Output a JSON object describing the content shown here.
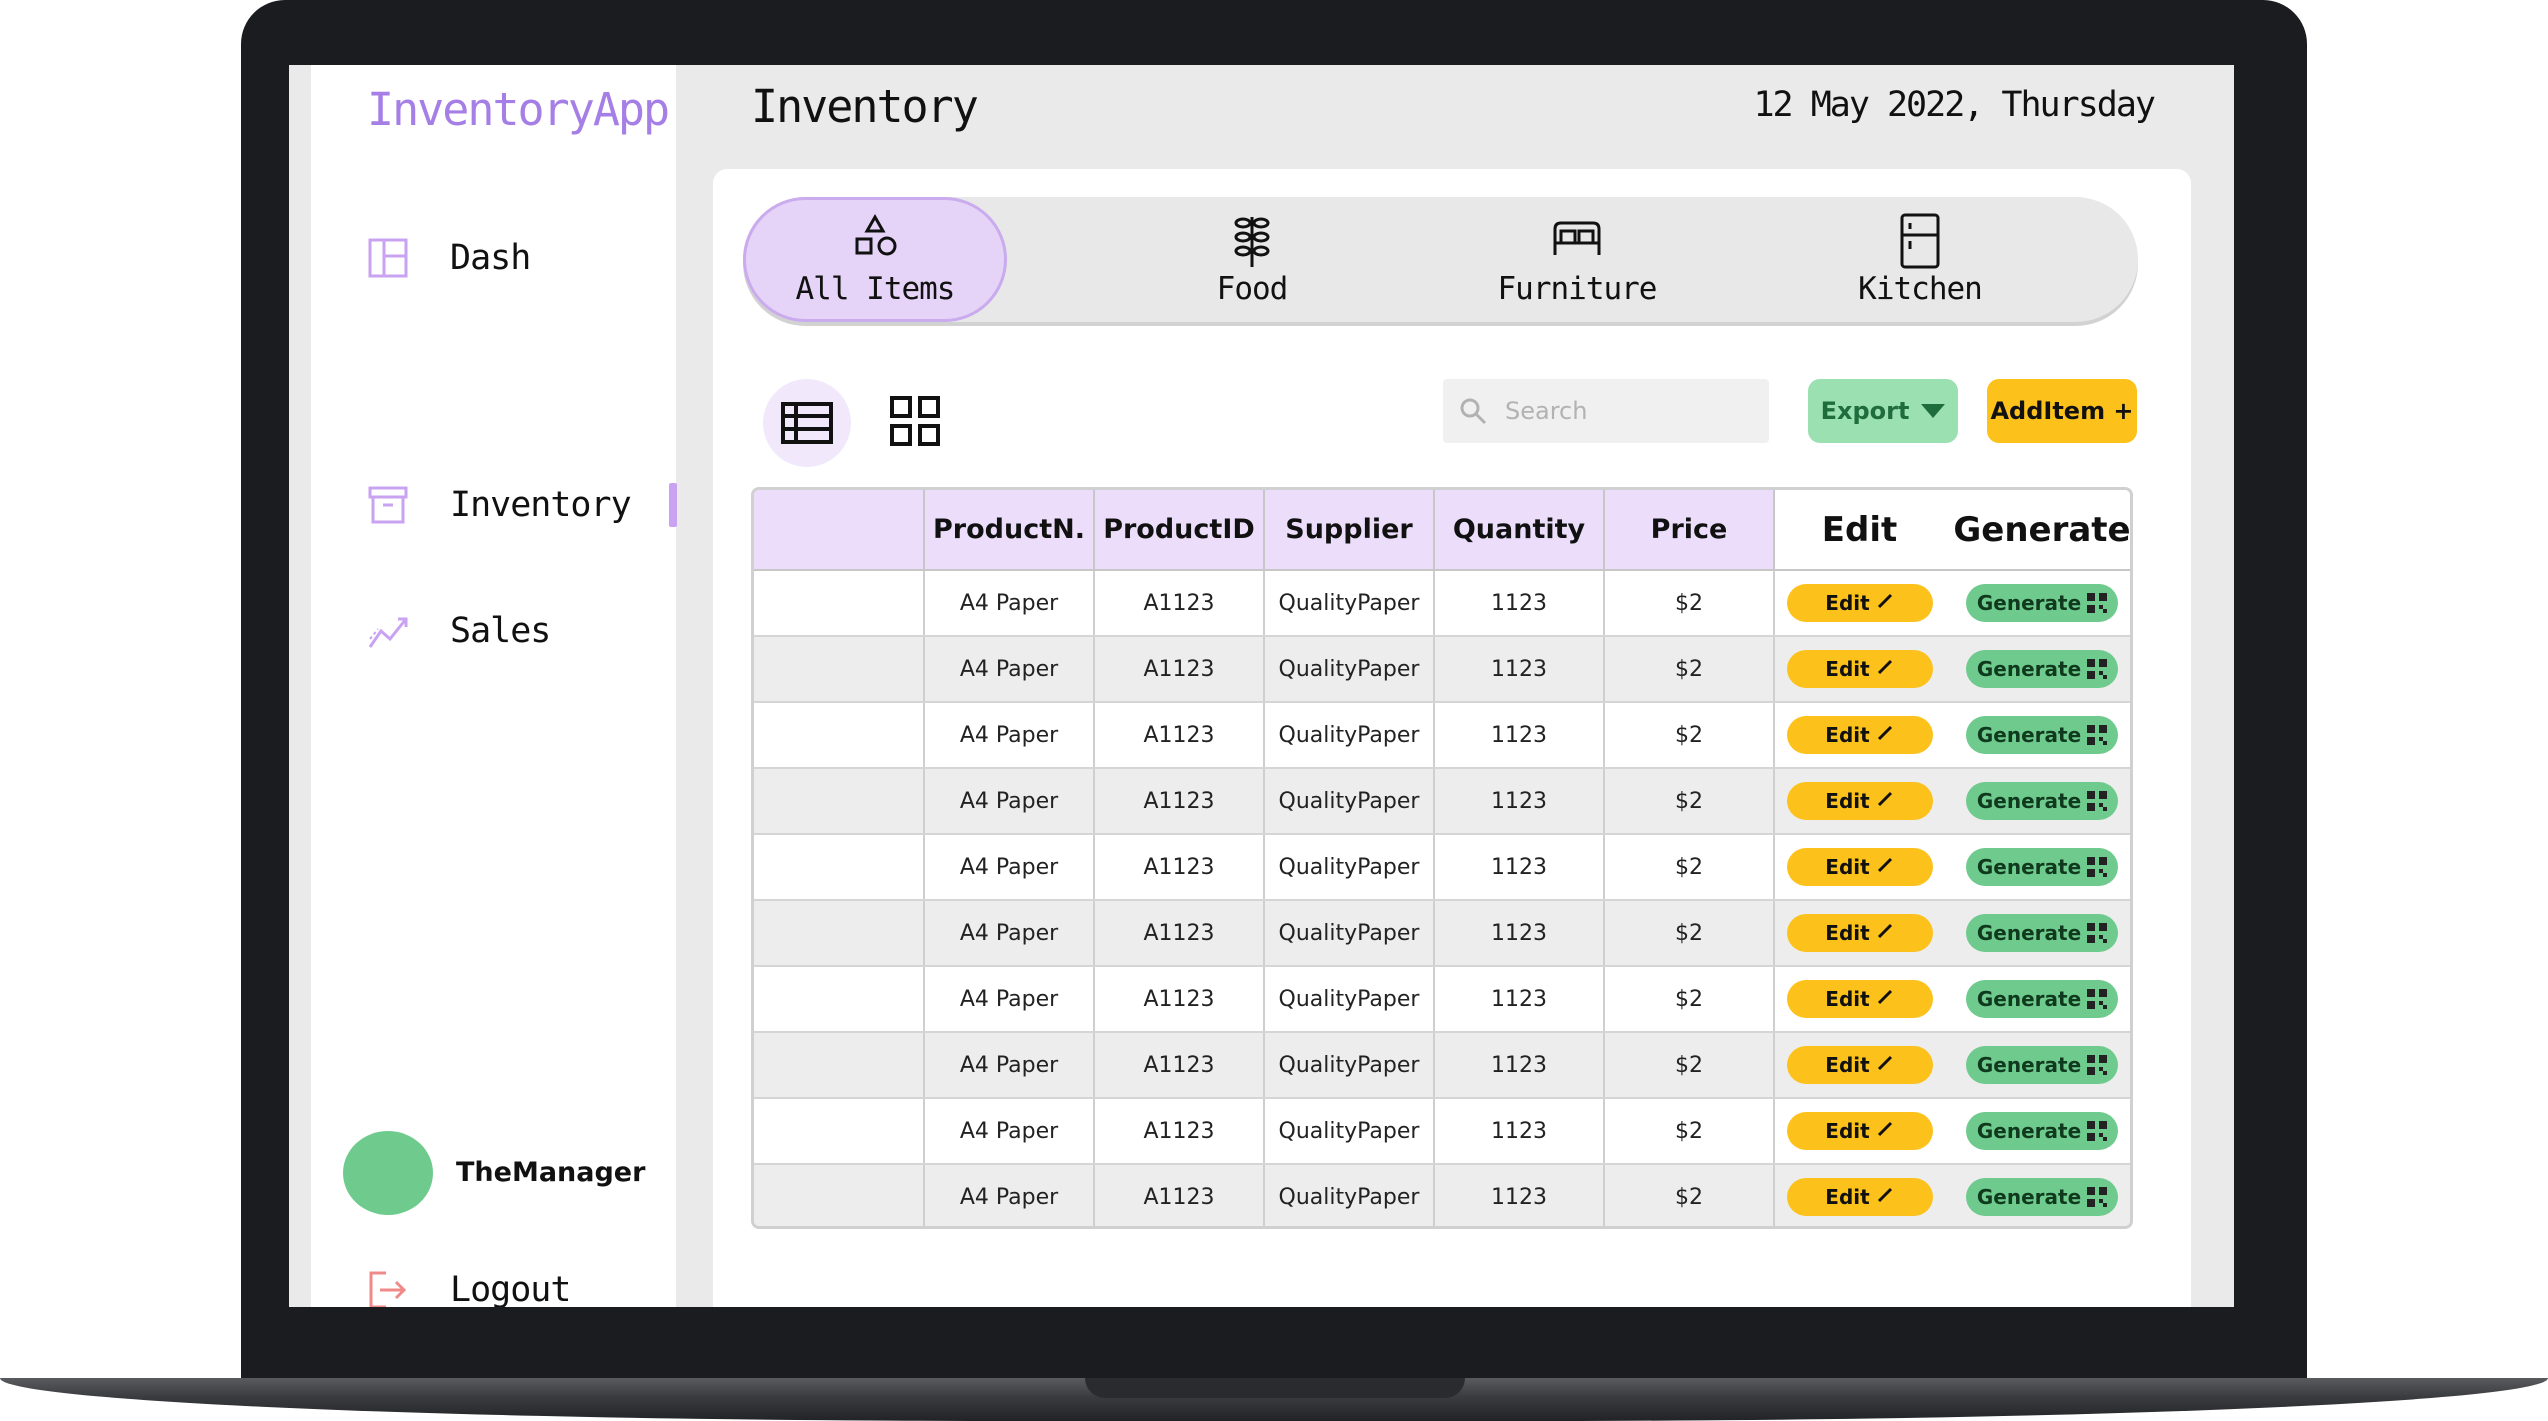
{
  "app": {
    "brand": "InventoryApp"
  },
  "sidebar": {
    "items": [
      {
        "label": "Dash",
        "icon": "dashboard-icon"
      },
      {
        "label": "Inventory",
        "icon": "archive-box-icon",
        "active": true
      },
      {
        "label": "Sales",
        "icon": "trend-chart-icon"
      }
    ],
    "user": {
      "name": "TheManager"
    },
    "logout_label": "Logout"
  },
  "header": {
    "title": "Inventory",
    "date": "12 May 2022, Thursday"
  },
  "categories": [
    {
      "label": "All Items",
      "icon": "shapes-icon",
      "active": true
    },
    {
      "label": "Food",
      "icon": "wheat-icon"
    },
    {
      "label": "Furniture",
      "icon": "bed-icon"
    },
    {
      "label": "Kitchen",
      "icon": "fridge-icon"
    }
  ],
  "toolbar": {
    "search_placeholder": "Search",
    "export_label": "Export",
    "add_label": "AddItem +"
  },
  "table": {
    "headers": [
      "",
      "ProductN.",
      "ProductID",
      "Supplier",
      "Quantity",
      "Price",
      "Edit",
      "Generate"
    ],
    "edit_label": "Edit",
    "generate_label": "Generate",
    "rows": [
      [
        "",
        "A4 Paper",
        "A1123",
        "QualityPaper",
        "1123",
        "$2"
      ],
      [
        "",
        "A4 Paper",
        "A1123",
        "QualityPaper",
        "1123",
        "$2"
      ],
      [
        "",
        "A4 Paper",
        "A1123",
        "QualityPaper",
        "1123",
        "$2"
      ],
      [
        "",
        "A4 Paper",
        "A1123",
        "QualityPaper",
        "1123",
        "$2"
      ],
      [
        "",
        "A4 Paper",
        "A1123",
        "QualityPaper",
        "1123",
        "$2"
      ],
      [
        "",
        "A4 Paper",
        "A1123",
        "QualityPaper",
        "1123",
        "$2"
      ],
      [
        "",
        "A4 Paper",
        "A1123",
        "QualityPaper",
        "1123",
        "$2"
      ],
      [
        "",
        "A4 Paper",
        "A1123",
        "QualityPaper",
        "1123",
        "$2"
      ],
      [
        "",
        "A4 Paper",
        "A1123",
        "QualityPaper",
        "1123",
        "$2"
      ],
      [
        "",
        "A4 Paper",
        "A1123",
        "QualityPaper",
        "1123",
        "$2"
      ]
    ]
  },
  "colors": {
    "accent_purple": "#a57ee6",
    "active_bg": "#e5d4f7",
    "edit_yellow": "#fcc21b",
    "generate_green": "#6fcb8d",
    "export_green": "#9be0b1"
  }
}
